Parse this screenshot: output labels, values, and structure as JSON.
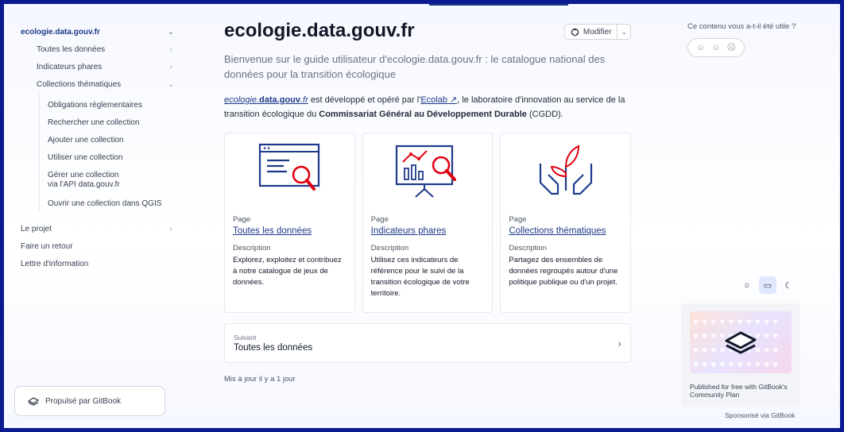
{
  "sidebar": {
    "root": "ecologie.data.gouv.fr",
    "items": [
      {
        "label": "Toutes les données"
      },
      {
        "label": "Indicateurs phares"
      },
      {
        "label": "Collections thématiques"
      }
    ],
    "sub_items": [
      {
        "label": "Obligations règlementaires"
      },
      {
        "label": "Rechercher une collection"
      },
      {
        "label": "Ajouter une collection"
      },
      {
        "label": "Utiliser une collection"
      },
      {
        "label_line1": "Gérer une collection",
        "label_line2": "via l'API data.gouv.fr"
      },
      {
        "label": "Ouvrir une collection dans QGIS"
      }
    ],
    "top_items": [
      {
        "label": "Le projet"
      },
      {
        "label": "Faire un retour"
      },
      {
        "label": "Lettre d'information"
      }
    ],
    "powered_by": "Propulsé par GitBook"
  },
  "main": {
    "title": "ecologie.data.gouv.fr",
    "edit_label": "Modifier",
    "subtitle": "Bienvenue sur le guide utilisateur d'ecologie.data.gouv.fr : le catalogue national des données pour la transition écologique",
    "intro": {
      "brand_italic": "ecologie.",
      "brand_bold": "data.gouv",
      "brand_end": ".fr",
      "text1": " est développé et opéré par l'",
      "ecolab": "Ecolab ↗",
      "text2": ", le laboratoire d'innovation au service de la transition écologique du ",
      "cgdd": "Commissariat Général au Développement Durable",
      "text3": " (CGDD)."
    },
    "cards": [
      {
        "type": "Page",
        "title": "Toutes les données",
        "desc_label": "Description",
        "desc": "Explorez, exploitez et contribuez à notre catalogue de jeux de données."
      },
      {
        "type": "Page",
        "title": "Indicateurs phares",
        "desc_label": "Description",
        "desc": "Utilisez ces indicateurs de référence pour le suivi de la transition écologique de votre territoire."
      },
      {
        "type": "Page",
        "title": "Collections thématiques",
        "desc_label": "Description",
        "desc": "Partagez des ensembles de données regroupés autour d'une politique publique ou d'un projet."
      }
    ],
    "next": {
      "small": "Suivant",
      "title": "Toutes les données"
    },
    "updated": "Mis à jour il y a 1 jour"
  },
  "right": {
    "feedback_question": "Ce contenu vous a-t-il été utile ?",
    "sponsor_text": "Published for free with GitBook's Community Plan",
    "sponsor_by": "Sponsorisé via GitBook"
  },
  "colors": {
    "accent": "#1e3a8a",
    "frame": "#0b1b8f",
    "icon_red": "#e1000f"
  }
}
